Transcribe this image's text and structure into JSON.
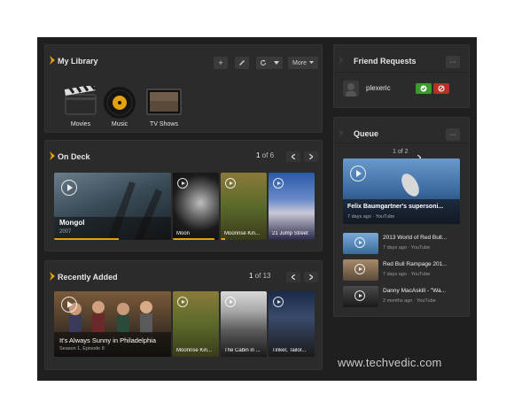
{
  "library": {
    "title": "My Library",
    "add": "+",
    "more_label": "More",
    "items": [
      {
        "label": "Movies"
      },
      {
        "label": "Music"
      },
      {
        "label": "TV Shows"
      }
    ]
  },
  "on_deck": {
    "title": "On Deck",
    "page_current": "1",
    "page_total": " of 6",
    "featured": {
      "title": "Mongol",
      "year": "2007",
      "progress": 0.55
    },
    "items": [
      {
        "label": "Moon",
        "progress": 0.9
      },
      {
        "label": "Moonrise Kin...",
        "progress": 0.1
      },
      {
        "label": "21 Jump Street",
        "progress": 0.0
      }
    ]
  },
  "recent": {
    "title": "Recently Added",
    "page_current": "1",
    "page_total": " of 13",
    "featured": {
      "title": "It's Always Sunny in Philadelphia",
      "subtitle": "Season 1, Episode 8"
    },
    "items": [
      {
        "label": "Moonrise Kin..."
      },
      {
        "label": "The Cabin in ..."
      },
      {
        "label": "Tinker, Tailor..."
      }
    ]
  },
  "friends": {
    "title": "Friend Requests",
    "more": "···",
    "user": "plexeric"
  },
  "queue": {
    "title": "Queue",
    "more": "···",
    "page": "1 of 2",
    "featured": {
      "title": "Felix Baumgartner's supersoni...",
      "meta": "7 days ago · YouTube"
    },
    "items": [
      {
        "title": "2013 World of Red Bull...",
        "meta": "7 days ago · YouTube"
      },
      {
        "title": "Red Bull Rampage 201...",
        "meta": "7 days ago · YouTube"
      },
      {
        "title": "Danny MacAskill - \"Wa...",
        "meta": "2 months ago · YouTube"
      }
    ]
  },
  "watermark": "www.techvedic.com",
  "colors": {
    "accent": "#e5a00d",
    "accept": "#3c9a2e",
    "decline": "#b8302a"
  }
}
